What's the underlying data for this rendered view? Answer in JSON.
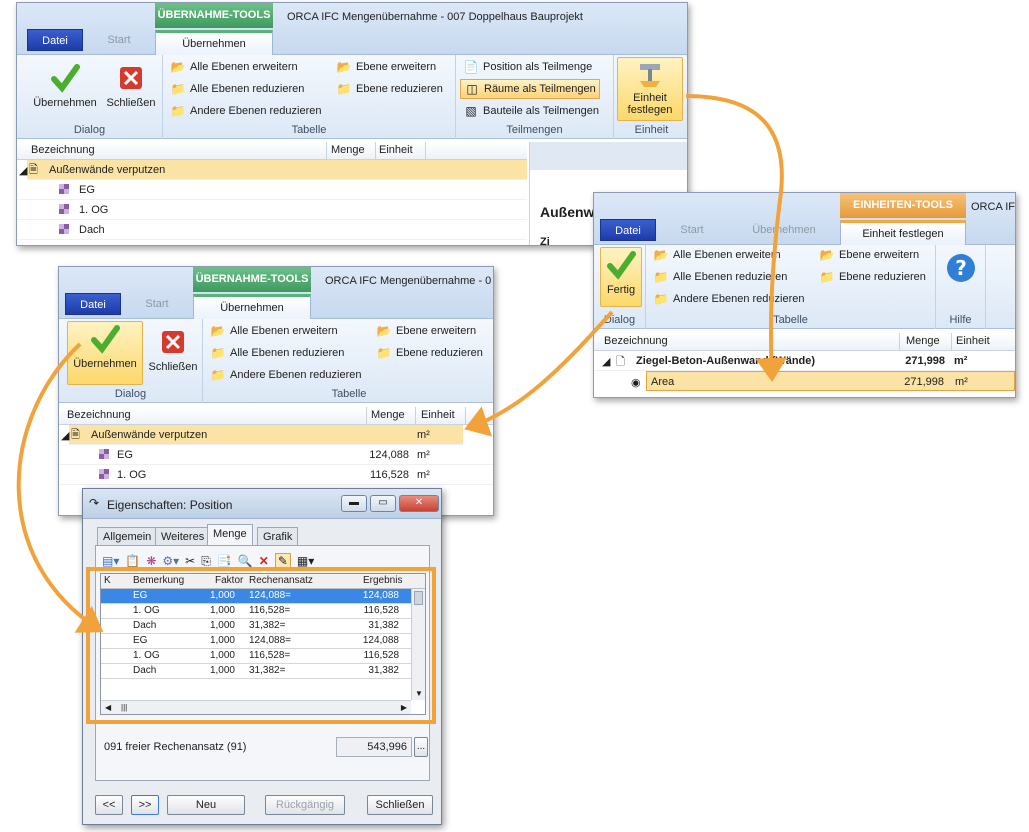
{
  "window1": {
    "context_tab": "ÜBERNAHME-TOOLS",
    "title": "ORCA IFC Mengenübernahme - 007 Doppelhaus Bauprojekt",
    "tabs": [
      "Datei",
      "Start",
      "Übernehmen"
    ],
    "ribbon": {
      "dialog": {
        "label": "Dialog",
        "buttons": [
          "Übernehmen",
          "Schließen"
        ]
      },
      "tabelle": {
        "label": "Tabelle",
        "buttons": [
          "Alle Ebenen erweitern",
          "Alle Ebenen reduzieren",
          "Andere Ebenen reduzieren",
          "Ebene erweitern",
          "Ebene reduzieren"
        ]
      },
      "teilmengen": {
        "label": "Teilmengen",
        "buttons": [
          "Position als Teilmenge",
          "Räume als Teilmengen",
          "Bauteile als Teilmengen"
        ]
      },
      "einheit": {
        "label": "Einheit",
        "button": "Einheit festlegen"
      }
    },
    "grid": {
      "headers": [
        "Bezeichnung",
        "Menge",
        "Einheit"
      ],
      "parent": "Außenwände verputzen",
      "rows": [
        "EG",
        "1. OG",
        "Dach"
      ]
    },
    "side_text": "Außenw",
    "side_text2": "Zi"
  },
  "window2": {
    "context_tab": "EINHEITEN-TOOLS",
    "title": "ORCA IFC",
    "tabs": [
      "Datei",
      "Start",
      "Übernehmen",
      "Einheit festlegen"
    ],
    "ribbon": {
      "dialog": {
        "label": "Dialog",
        "button": "Fertig"
      },
      "tabelle": {
        "label": "Tabelle",
        "buttons": [
          "Alle Ebenen erweitern",
          "Alle Ebenen reduzieren",
          "Andere Ebenen reduzieren",
          "Ebene erweitern",
          "Ebene reduzieren"
        ]
      },
      "hilfe": {
        "label": "Hilfe"
      }
    },
    "grid": {
      "headers": [
        "Bezeichnung",
        "Menge",
        "Einheit"
      ],
      "rows": [
        {
          "name": "Ziegel-Beton-Außenwand (Wände)",
          "menge": "271,998",
          "einheit": "m²"
        },
        {
          "name": "Area",
          "menge": "271,998",
          "einheit": "m²"
        }
      ]
    }
  },
  "window3": {
    "context_tab": "ÜBERNAHME-TOOLS",
    "title": "ORCA IFC Mengenübernahme - 0",
    "tabs": [
      "Datei",
      "Start",
      "Übernehmen"
    ],
    "ribbon": {
      "dialog": {
        "label": "Dialog",
        "buttons": [
          "Übernehmen",
          "Schließen"
        ]
      },
      "tabelle": {
        "label": "Tabelle",
        "buttons": [
          "Alle Ebenen erweitern",
          "Alle Ebenen reduzieren",
          "Andere Ebenen reduzieren",
          "Ebene erweitern",
          "Ebene reduzieren"
        ]
      }
    },
    "grid": {
      "headers": [
        "Bezeichnung",
        "Menge",
        "Einheit"
      ],
      "parent": {
        "name": "Außenwände verputzen",
        "einheit": "m²"
      },
      "rows": [
        {
          "name": "EG",
          "menge": "124,088",
          "einheit": "m²"
        },
        {
          "name": "1. OG",
          "menge": "116,528",
          "einheit": "m²"
        }
      ]
    }
  },
  "dialog": {
    "title": "Eigenschaften: Position",
    "tabs": [
      "Allgemein",
      "Weiteres",
      "Menge",
      "Grafik"
    ],
    "table": {
      "headers": [
        "K",
        "Bemerkung",
        "Faktor",
        "Rechenansatz",
        "Ergebnis"
      ],
      "rows": [
        {
          "bem": "EG",
          "faktor": "1,000",
          "ansatz": "124,088=",
          "ergebnis": "124,088"
        },
        {
          "bem": "1. OG",
          "faktor": "1,000",
          "ansatz": "116,528=",
          "ergebnis": "116,528"
        },
        {
          "bem": "Dach",
          "faktor": "1,000",
          "ansatz": "31,382=",
          "ergebnis": "31,382"
        },
        {
          "bem": "EG",
          "faktor": "1,000",
          "ansatz": "124,088=",
          "ergebnis": "124,088"
        },
        {
          "bem": "1. OG",
          "faktor": "1,000",
          "ansatz": "116,528=",
          "ergebnis": "116,528"
        },
        {
          "bem": "Dach",
          "faktor": "1,000",
          "ansatz": "31,382=",
          "ergebnis": "31,382"
        }
      ]
    },
    "formula_label": "091 freier Rechenansatz (91)",
    "formula_value": "543,996",
    "ellipsis": "...",
    "buttons": {
      "prev": "<<",
      "next": ">>",
      "neu": "Neu",
      "undo": "Rückgängig",
      "close": "Schließen"
    }
  },
  "colors": {
    "accent_orange": "#f2a23a",
    "green_tab": "#4fa86c",
    "file_blue": "#2446b8",
    "selection": "#fbe3a6"
  }
}
